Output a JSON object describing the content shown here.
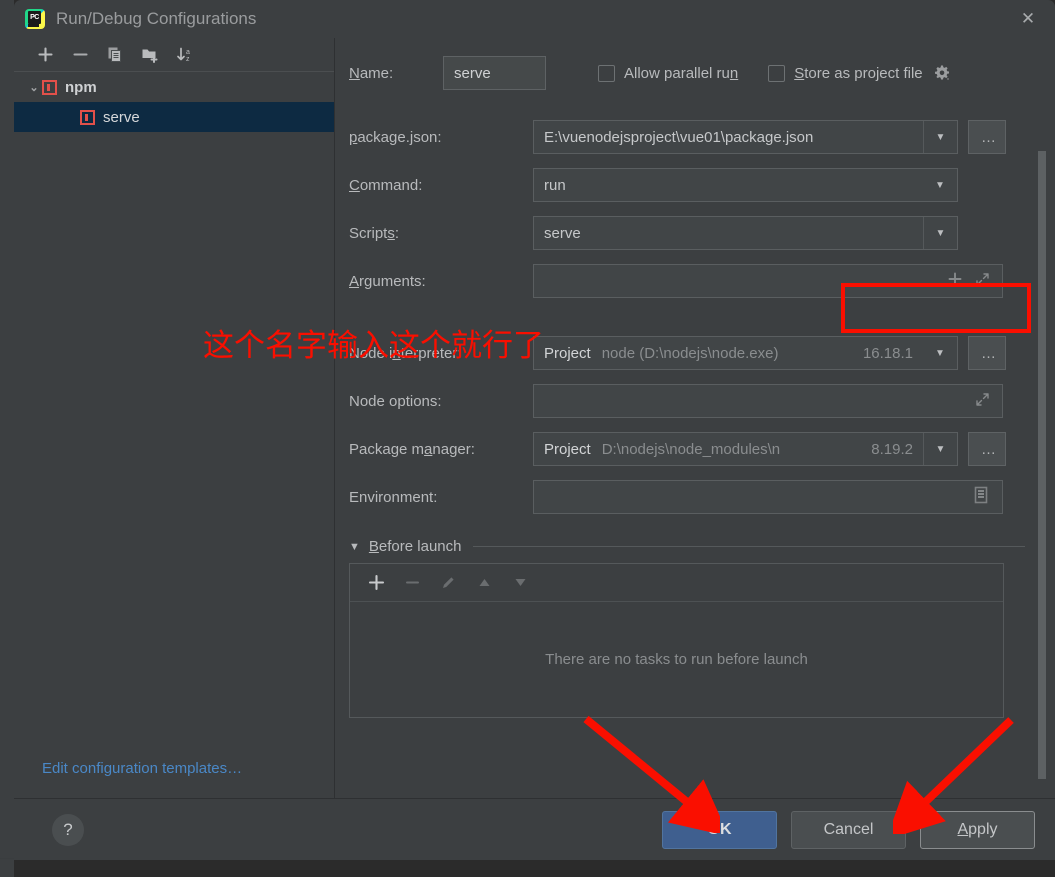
{
  "window": {
    "title": "Run/Debug Configurations",
    "logo_icon": "pycharm-logo-icon",
    "close_icon": "close-icon",
    "close_glyph": "✕"
  },
  "sidebar": {
    "toolbar": [
      {
        "name": "add-configuration-button",
        "icon": "plus-icon"
      },
      {
        "name": "remove-configuration-button",
        "icon": "minus-icon"
      },
      {
        "name": "copy-configuration-button",
        "icon": "copy-icon"
      },
      {
        "name": "new-folder-button",
        "icon": "folder-add-icon"
      },
      {
        "name": "sort-configurations-button",
        "icon": "sort-az-icon"
      }
    ],
    "tree": [
      {
        "label": "npm",
        "type": "group",
        "expanded": true,
        "chevron": "⌄",
        "icon": "npm-icon",
        "selected": false
      },
      {
        "label": "serve",
        "type": "child",
        "icon": "npm-icon",
        "selected": true
      }
    ],
    "edit_templates_link": "Edit configuration templates…"
  },
  "form": {
    "name": {
      "label": "Name:",
      "label_mnemonic": "N",
      "label_rest": "ame:",
      "value": "serve"
    },
    "allow_parallel_run": {
      "label_pre": "Allow parallel ru",
      "label_mnemonic": "n",
      "label_post": "",
      "full_label": "Allow parallel run",
      "checked": false
    },
    "store_as_project_file": {
      "label_mnemonic": "S",
      "label_rest": "tore as project file",
      "full_label": "Store as project file",
      "checked": false,
      "gear_icon": "gear-dropdown-icon"
    },
    "rows": [
      {
        "id": "packagejson",
        "label_mnemonic": "p",
        "label_rest": "ackage.json:",
        "full_label": "package.json:",
        "value": "E:\\vuenodejsproject\\vue01\\package.json",
        "has_dropdown": true,
        "browse_label": "…"
      },
      {
        "id": "command",
        "label_mnemonic": "C",
        "label_rest": "ommand:",
        "full_label": "Command:",
        "value": "run",
        "has_dropdown": true,
        "browse_label": ""
      },
      {
        "id": "scripts",
        "label_mnemonic": "",
        "label_rest": "Script",
        "label_mnemonic2": "s",
        "label_tail": ":",
        "full_label": "Scripts:",
        "value": "serve",
        "has_dropdown": true,
        "highlighted": true,
        "browse_label": ""
      },
      {
        "id": "arguments",
        "label_mnemonic": "A",
        "label_rest": "rguments:",
        "full_label": "Arguments:",
        "value": "",
        "placeholder": "",
        "icons": [
          "plus-icon",
          "expand-icon"
        ],
        "browse_label": ""
      },
      {
        "id": "node_interpreter",
        "label_pre": "Node i",
        "label_mnemonic": "n",
        "label_rest": "terpreter:",
        "full_label": "Node interpreter:",
        "scope": "Project",
        "path": "node (D:\\nodejs\\node.exe)",
        "version": "16.18.1",
        "has_dropdown": true,
        "browse_label": "…"
      },
      {
        "id": "node_options",
        "full_label": "Node options:",
        "value": "",
        "icons": [
          "expand-icon"
        ],
        "browse_label": ""
      },
      {
        "id": "package_manager",
        "label_pre": "Package m",
        "label_mnemonic": "a",
        "label_rest": "nager:",
        "full_label": "Package manager:",
        "scope": "Project",
        "path": "D:\\nodejs\\node_modules\\n",
        "version": "8.19.2",
        "has_dropdown": true,
        "browse_label": "…"
      },
      {
        "id": "environment",
        "full_label": "Environment:",
        "value": "",
        "icons": [
          "environment-list-icon"
        ],
        "browse_label": ""
      }
    ],
    "before_launch": {
      "chevron": "▼",
      "label_mnemonic": "B",
      "label_rest": "efore launch",
      "full_label": "Before launch",
      "toolbar": [
        {
          "name": "add-task-button",
          "icon": "plus-icon",
          "enabled": true
        },
        {
          "name": "remove-task-button",
          "icon": "minus-icon",
          "enabled": false
        },
        {
          "name": "edit-task-button",
          "icon": "pencil-icon",
          "enabled": false
        },
        {
          "name": "move-task-up-button",
          "icon": "arrow-up-icon",
          "enabled": false
        },
        {
          "name": "move-task-down-button",
          "icon": "arrow-down-icon",
          "enabled": false
        }
      ],
      "empty_text": "There are no tasks to run before launch"
    }
  },
  "footer": {
    "help_label": "?",
    "ok_label": "OK",
    "cancel_label": "Cancel",
    "apply_mnemonic": "A",
    "apply_rest": "pply",
    "apply_label": "Apply"
  },
  "annotations": {
    "note_text": "这个名字输入这个就行了",
    "color": "#fa0f00",
    "arrows": [
      {
        "name": "arrow-to-ok-button",
        "target": "OK"
      },
      {
        "name": "arrow-to-apply-button",
        "target": "Apply"
      }
    ],
    "highlight_box_target": "Scripts"
  },
  "colors": {
    "dialog_bg": "#3c3f41",
    "field_bg": "#414547",
    "selection_bg": "#0d2a42",
    "accent_blue": "#3f5f8f",
    "link_blue": "#4a88c7",
    "annotation_red": "#fa0f00",
    "npm_icon_red": "#e2504a"
  }
}
